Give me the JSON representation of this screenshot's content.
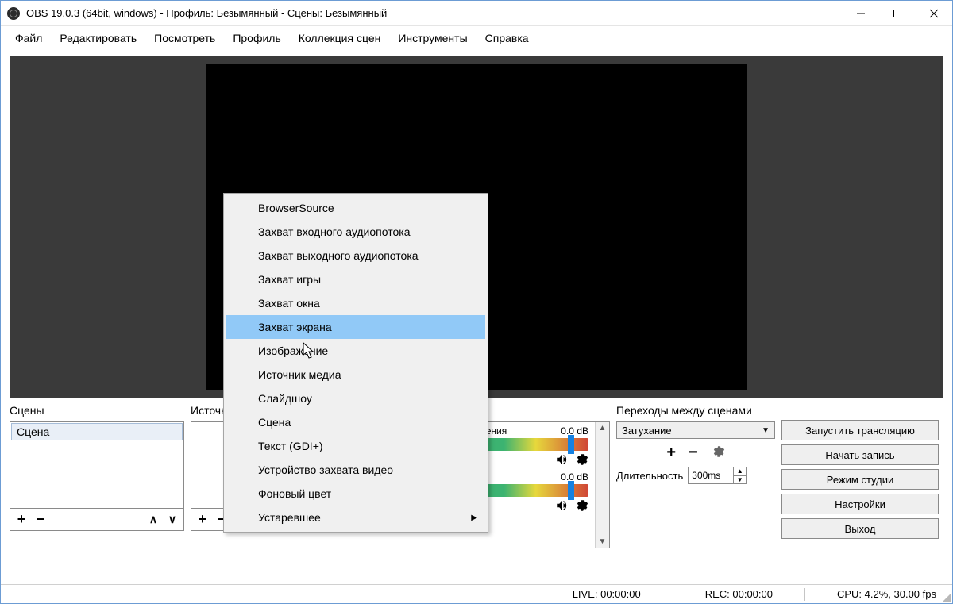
{
  "title": "OBS 19.0.3 (64bit, windows) - Профиль: Безымянный - Сцены: Безымянный",
  "menu": [
    "Файл",
    "Редактировать",
    "Посмотреть",
    "Профиль",
    "Коллекция сцен",
    "Инструменты",
    "Справка"
  ],
  "scenes": {
    "label": "Сцены",
    "items": [
      "Сцена"
    ]
  },
  "sources": {
    "label": "Источники"
  },
  "mixer": {
    "items": [
      {
        "name": "Устройство воспроизведения",
        "db": "0.0 dB"
      },
      {
        "name": "",
        "db": "0.0 dB"
      }
    ]
  },
  "transitions": {
    "label": "Переходы между сценами",
    "selected": "Затухание",
    "duration_label": "Длительность",
    "duration_value": "300ms"
  },
  "controls": {
    "start_stream": "Запустить трансляцию",
    "start_record": "Начать запись",
    "studio_mode": "Режим студии",
    "settings": "Настройки",
    "exit": "Выход"
  },
  "context_menu": {
    "items": [
      "BrowserSource",
      "Захват входного аудиопотока",
      "Захват выходного аудиопотока",
      "Захват игры",
      "Захват окна",
      "Захват экрана",
      "Изображение",
      "Источник медиа",
      "Слайдшоу",
      "Сцена",
      "Текст (GDI+)",
      "Устройство захвата видео",
      "Фоновый цвет",
      "Устаревшее"
    ],
    "selected_index": 5,
    "submenu_index": 13
  },
  "status": {
    "live": "LIVE: 00:00:00",
    "rec": "REC: 00:00:00",
    "cpu": "CPU: 4.2%, 30.00 fps"
  }
}
